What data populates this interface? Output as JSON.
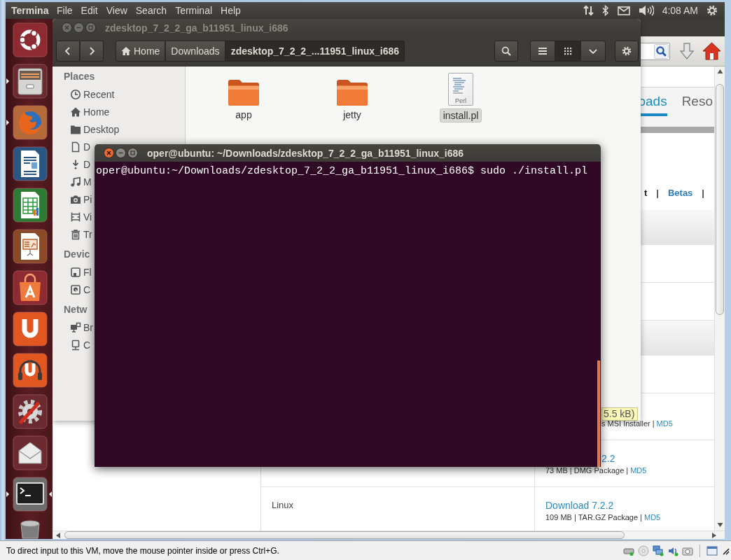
{
  "top_panel": {
    "app_title": "Termina",
    "menus": [
      "File",
      "Edit",
      "View",
      "Search",
      "Terminal",
      "Help"
    ],
    "clock": "4:08 AM"
  },
  "launcher": [
    {
      "kind": "dash",
      "running": false,
      "focused": false
    },
    {
      "kind": "files",
      "running": true,
      "focused": false
    },
    {
      "kind": "browser",
      "running": true,
      "focused": false
    },
    {
      "kind": "writer",
      "running": false,
      "focused": false
    },
    {
      "kind": "calc",
      "running": false,
      "focused": false
    },
    {
      "kind": "impress",
      "running": false,
      "focused": false
    },
    {
      "kind": "store",
      "running": false,
      "focused": false
    },
    {
      "kind": "cloud",
      "running": false,
      "focused": false
    },
    {
      "kind": "music",
      "running": false,
      "focused": false
    },
    {
      "kind": "settings",
      "running": false,
      "focused": false
    },
    {
      "kind": "mail",
      "running": false,
      "focused": false
    },
    {
      "kind": "terminal",
      "running": true,
      "focused": true
    },
    {
      "kind": "trash",
      "running": false,
      "focused": false
    }
  ],
  "file_manager": {
    "title": "zdesktop_7_2_2_ga_b11951_linux_i686",
    "focused": false,
    "path": [
      {
        "label": "Home",
        "kind": "home",
        "selected": false
      },
      {
        "label": "Downloads",
        "kind": "folder",
        "selected": false
      },
      {
        "label": "zdesktop_7_2_2_...11951_linux_i686",
        "kind": "folder",
        "selected": true
      }
    ],
    "view_modes": [
      {
        "kind": "list",
        "selected": false
      },
      {
        "kind": "grid",
        "selected": true
      }
    ],
    "sidebar": [
      {
        "heading": "Places",
        "items": [
          {
            "label": "Recent",
            "kind": "recent",
            "selected": false
          },
          {
            "label": "Home",
            "kind": "home",
            "selected": false
          },
          {
            "label": "Desktop",
            "kind": "desktop",
            "selected": false
          },
          {
            "label": "D",
            "kind": "documents",
            "selected": false
          },
          {
            "label": "D",
            "kind": "downloads",
            "selected": false
          },
          {
            "label": "M",
            "kind": "music",
            "selected": false
          },
          {
            "label": "Pi",
            "kind": "pictures",
            "selected": false
          },
          {
            "label": "Vi",
            "kind": "videos",
            "selected": false
          },
          {
            "label": "Tr",
            "kind": "trash",
            "selected": false
          }
        ]
      },
      {
        "heading": "Devic",
        "items": [
          {
            "label": "Fl",
            "kind": "floppy",
            "selected": false
          },
          {
            "label": "C",
            "kind": "drive",
            "selected": false
          }
        ]
      },
      {
        "heading": "Netw",
        "items": [
          {
            "label": "Br",
            "kind": "network",
            "selected": false
          },
          {
            "label": "C",
            "kind": "server",
            "selected": false
          }
        ]
      }
    ],
    "files": [
      {
        "name": "app",
        "kind": "folder",
        "selected": false
      },
      {
        "name": "jetty",
        "kind": "folder",
        "selected": false
      },
      {
        "name": "install.pl",
        "kind": "script",
        "type_label": "Perl",
        "selected": true
      }
    ]
  },
  "terminal": {
    "title": "oper@ubuntu: ~/Downloads/zdesktop_7_2_2_ga_b11951_linux_i686",
    "focused": true,
    "lines": [
      "oper@ubuntu:~/Downloads/zdesktop_7_2_2_ga_b11951_linux_i686$ sudo ./install.pl"
    ]
  },
  "browser": {
    "tabs": [
      {
        "label": "oads",
        "selected": true
      },
      {
        "label": "Reso",
        "selected": false
      }
    ],
    "sub_links": [
      {
        "text": "t",
        "kind": "current"
      },
      {
        "text": "|",
        "kind": "separator"
      },
      {
        "text": "Betas",
        "kind": "link"
      },
      {
        "text": "|",
        "kind": "separator"
      }
    ],
    "table_rows": [
      {
        "kind": "header"
      },
      {
        "kind": "plain"
      },
      {
        "kind": "plain"
      },
      {
        "kind": "header"
      },
      {
        "kind": "plain"
      },
      {
        "kind": "download",
        "detail": {
          "text": "s MSI Installer |",
          "kind": "partial"
        },
        "checksum": "MD5"
      },
      {
        "kind": "download",
        "link": {
          "text": "2.2",
          "kind": "partial"
        },
        "detail": {
          "text": "73 MB | DMG Package |",
          "kind": "full"
        },
        "checksum": "MD5"
      },
      {
        "kind": "download",
        "platform": "Linux",
        "link": {
          "text": "Download 7.2.2",
          "kind": "full"
        },
        "detail": {
          "text": "109 MB | TAR.GZ Package |",
          "kind": "full"
        },
        "checksum": "MD5"
      }
    ],
    "tooltip": "5.5 kB)"
  },
  "status_bar": {
    "message": "To direct input to this VM, move the mouse pointer inside or press Ctrl+G."
  }
}
